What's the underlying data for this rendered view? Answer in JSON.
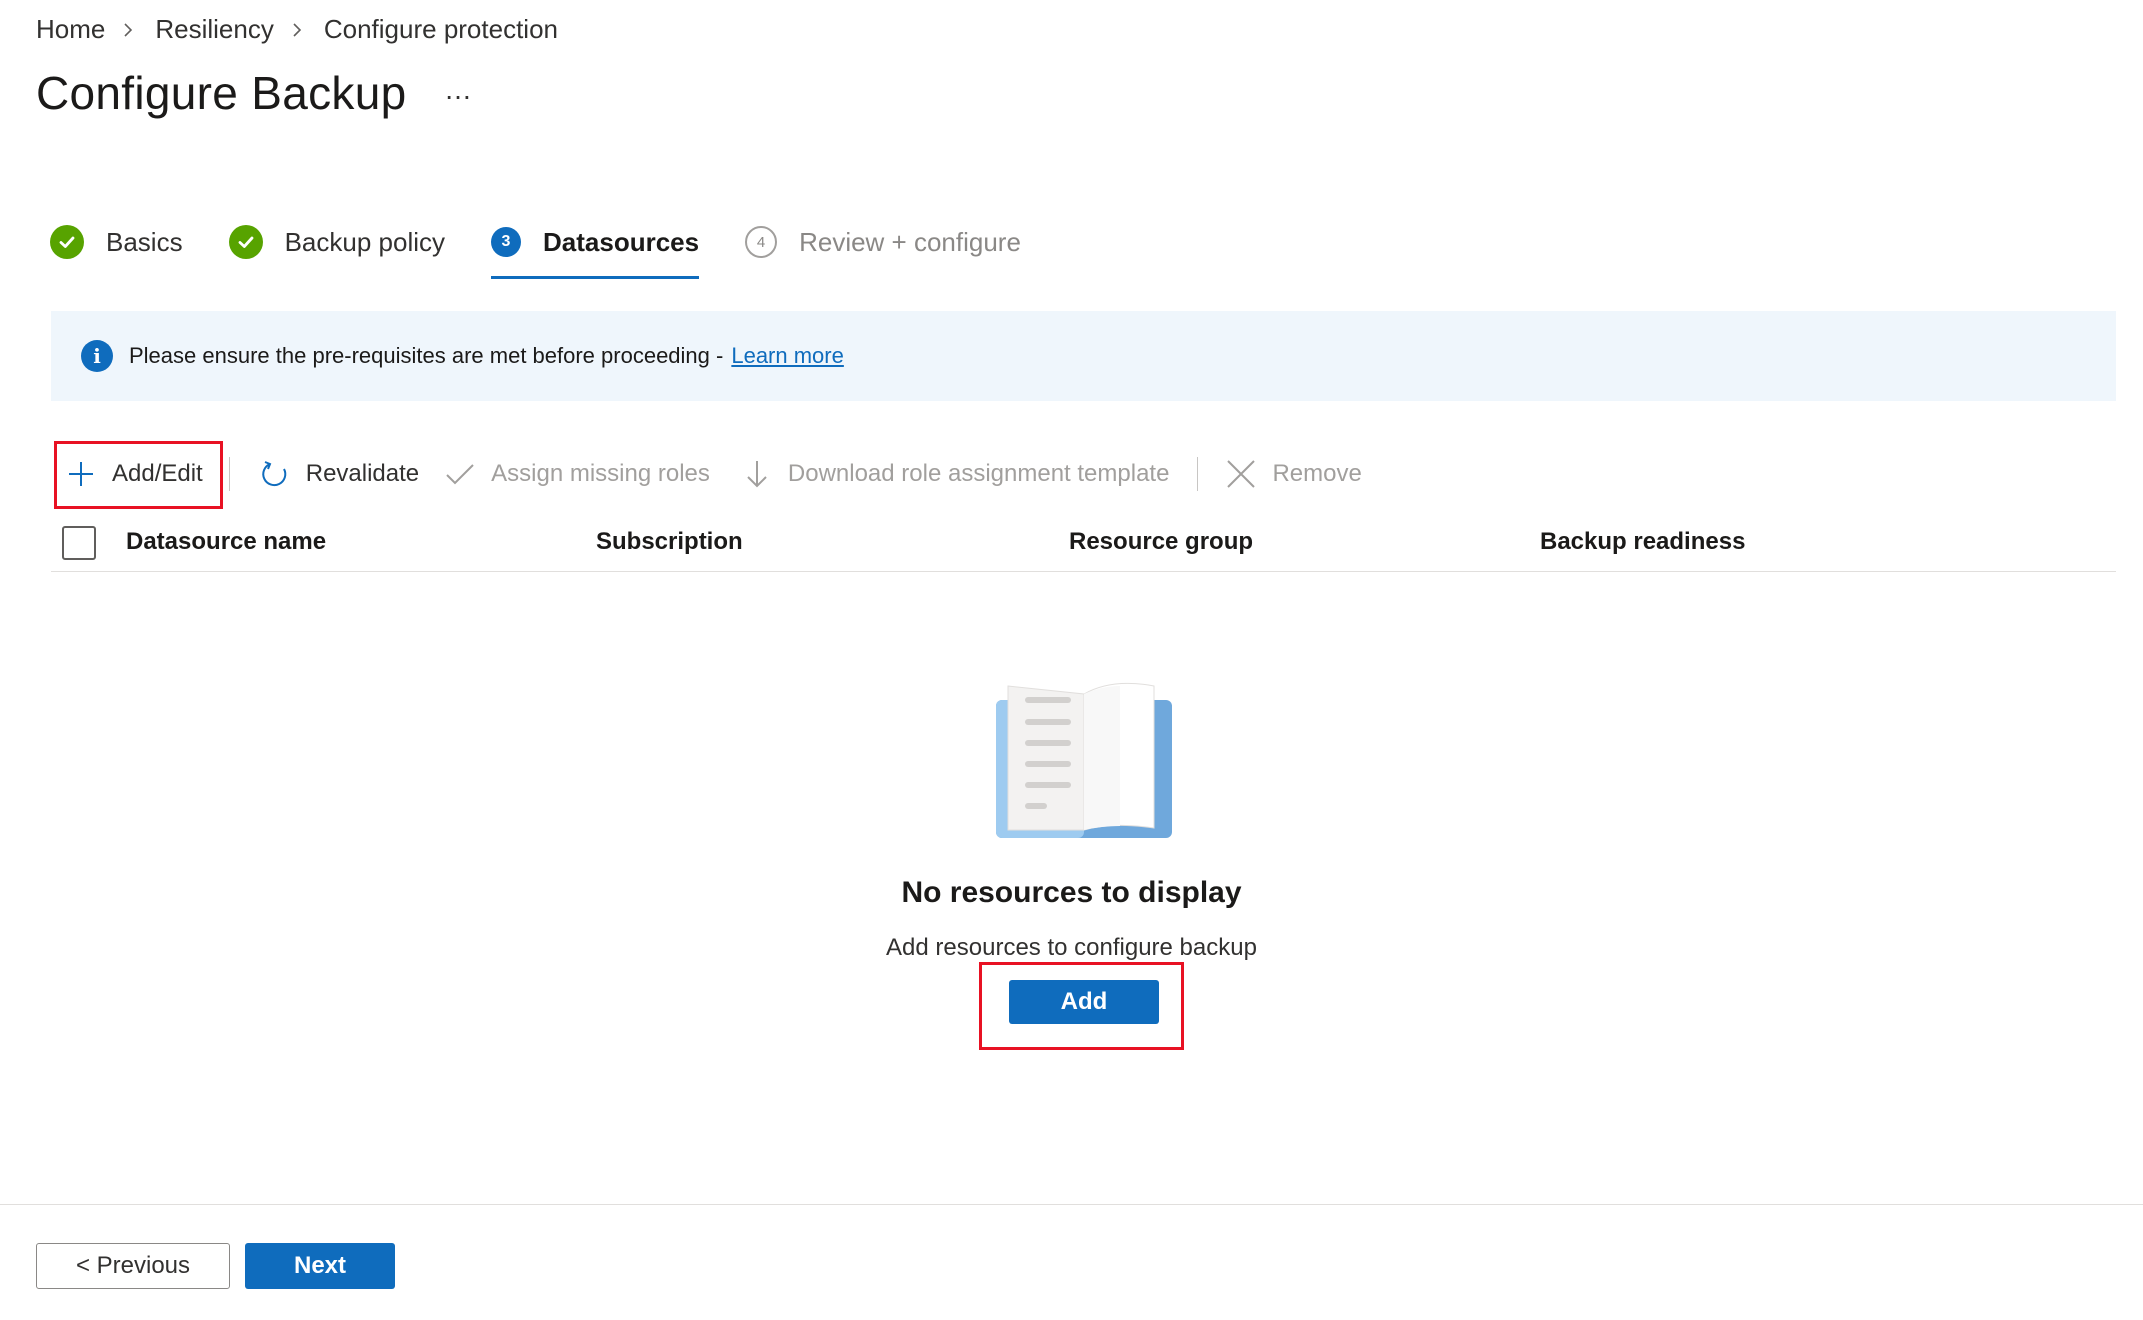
{
  "breadcrumb": {
    "items": [
      "Home",
      "Resiliency",
      "Configure protection"
    ]
  },
  "page": {
    "title": "Configure Backup",
    "more_label": "…"
  },
  "wizard": {
    "steps": [
      {
        "label": "Basics",
        "state": "completed",
        "icon": "check-circle-icon"
      },
      {
        "label": "Backup policy",
        "state": "completed",
        "icon": "check-circle-icon"
      },
      {
        "label": "Datasources",
        "state": "current",
        "number": "3"
      },
      {
        "label": "Review + configure",
        "state": "upcoming",
        "number": "4"
      }
    ]
  },
  "banner": {
    "icon": "info-icon",
    "message": "Please ensure the pre-requisites are met before proceeding -",
    "link": "Learn more"
  },
  "toolbar": {
    "add_edit": "Add/Edit",
    "revalidate": "Revalidate",
    "assign_roles": "Assign missing roles",
    "download_template": "Download role assignment template",
    "remove": "Remove"
  },
  "table": {
    "columns": [
      "Datasource name",
      "Subscription",
      "Resource group",
      "Backup readiness"
    ],
    "rows": []
  },
  "empty_state": {
    "title": "No resources to display",
    "subtitle": "Add resources to configure backup",
    "button": "Add",
    "illustration": "open-book-icon"
  },
  "footer": {
    "previous": "< Previous",
    "next": "Next"
  },
  "colors": {
    "accent": "#0f6cbd",
    "success": "#57a300",
    "highlight": "#e81123",
    "banner_bg": "#eff6fc"
  }
}
